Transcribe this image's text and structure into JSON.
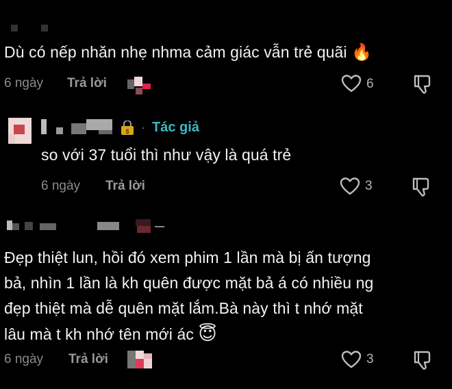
{
  "comments": [
    {
      "text": "Dù có nếp nhăn nhẹ nhma cảm giác vẫn trẻ quãi",
      "emoji": "🔥",
      "time": "6 ngày",
      "reply_label": "Trả lời",
      "likes": "6"
    },
    {
      "author_tag": "Tác giả",
      "text": "so với 37 tuổi thì như vậy là quá trẻ",
      "time": "6 ngày",
      "reply_label": "Trả lời",
      "likes": "3"
    },
    {
      "lines": [
        "Đẹp thiệt lun, hồi đó xem phim 1 lần mà bị ấn tượng",
        "bả, nhìn 1 lần là kh quên được mặt bả á có nhiều ng",
        "đẹp thiệt mà dễ quên mặt lắm.Bà này thì t nhớ mặt",
        "lâu mà t kh nhớ tên mới ác"
      ],
      "emoji": "😇",
      "time": "6 ngày",
      "reply_label": "Trả lời",
      "likes": "3"
    }
  ],
  "icons": {
    "like": "heart-outline-icon",
    "dislike": "thumbs-down-icon",
    "author_badge": "lock-badge-icon"
  }
}
